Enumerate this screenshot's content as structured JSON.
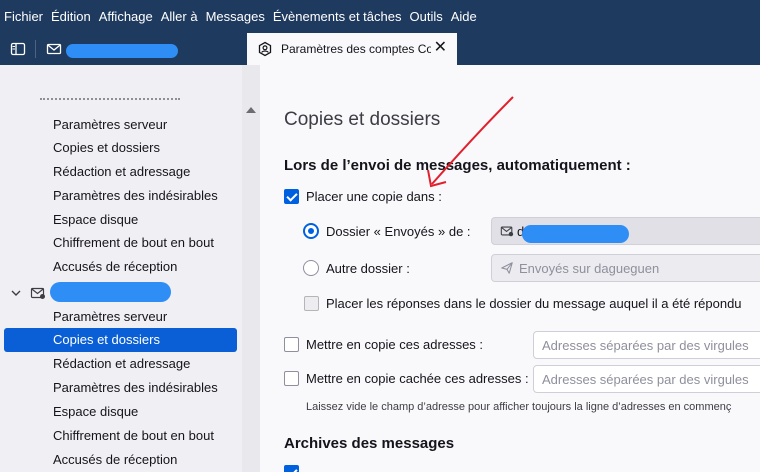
{
  "menubar": {
    "items": [
      {
        "label": "Fichier"
      },
      {
        "label": "Édition"
      },
      {
        "label": "Affichage"
      },
      {
        "label": "Aller à"
      },
      {
        "label": "Messages"
      },
      {
        "label": "Évènements et tâches"
      },
      {
        "label": "Outils"
      },
      {
        "label": "Aide"
      }
    ]
  },
  "tabs": {
    "active_label": "Paramètres des comptes Co",
    "close_glyph": "✕"
  },
  "sidebar": {
    "account1_items": [
      {
        "label": "Paramètres serveur"
      },
      {
        "label": "Copies et dossiers"
      },
      {
        "label": "Rédaction et adressage"
      },
      {
        "label": "Paramètres des indésirables"
      },
      {
        "label": "Espace disque"
      },
      {
        "label": "Chiffrement de bout en bout"
      },
      {
        "label": "Accusés de réception"
      }
    ],
    "account2_items": [
      {
        "label": "Paramètres serveur"
      },
      {
        "label": "Copies et dossiers",
        "selected": true
      },
      {
        "label": "Rédaction et adressage"
      },
      {
        "label": "Paramètres des indésirables"
      },
      {
        "label": "Espace disque"
      },
      {
        "label": "Chiffrement de bout en bout"
      },
      {
        "label": "Accusés de réception"
      }
    ]
  },
  "main": {
    "title": "Copies et dossiers",
    "section_send": "Lors de l’envoi de messages, automatiquement :",
    "place_copy": "Placer une copie dans :",
    "sent_folder_label": "Dossier « Envoyés » de :",
    "sent_folder_prefix": "d",
    "other_folder_label": "Autre dossier :",
    "other_folder_value": "Envoyés sur dagueguen",
    "reply_folder_label": "Placer les réponses dans le dossier du message auquel il a été répondu",
    "cc_label": "Mettre en copie ces adresses :",
    "cc_placeholder": "Adresses séparées par des virgules",
    "bcc_label": "Mettre en copie cachée ces adresses :",
    "bcc_placeholder": "Adresses séparées par des virgules",
    "hint": "Laissez vide le champ d’adresse pour afficher toujours la ligne d’adresses en commenç",
    "section_archives": "Archives des messages"
  },
  "colors": {
    "header_bg": "#1f3a5f",
    "selection": "#0a5fd6",
    "checkbox_on": "#0061e0",
    "annotation_arrow": "#e0202c",
    "redaction": "#2e8ef5"
  }
}
